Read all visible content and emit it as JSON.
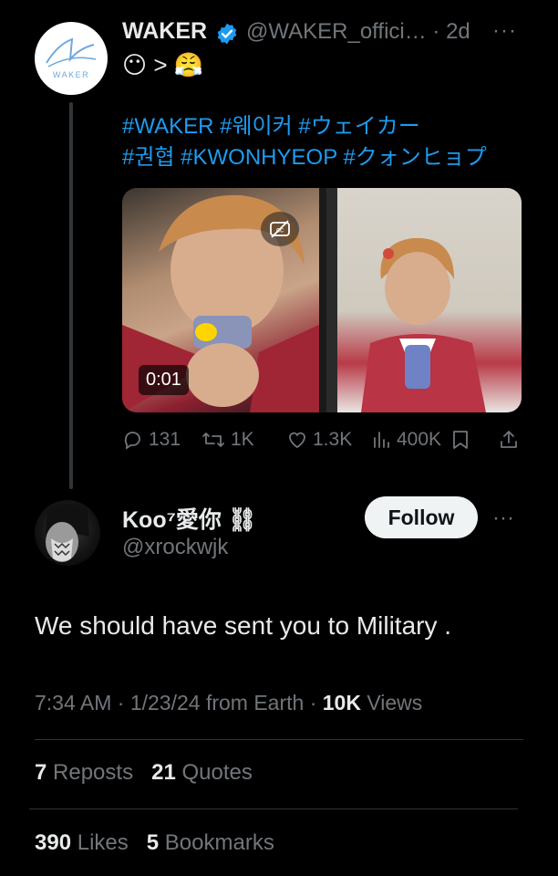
{
  "parent_tweet": {
    "name": "WAKER",
    "handle": "@WAKER_offici…",
    "time_ago": "· 2d",
    "more": "···",
    "emoji_text": "😶 > 😤",
    "hashtags_line1": "#WAKER #웨이커 #ウェイカー",
    "hashtags_line2": "#권협 #KWONHYEOP #クォンヒョプ",
    "avatar_logo_text": "WAKER",
    "video_time": "0:01",
    "actions": {
      "replies": "131",
      "reposts": "1K",
      "likes": "1.3K",
      "views": "400K"
    }
  },
  "reply": {
    "name": "Koo⁷愛你 ⛓",
    "handle": "@xrockwjk",
    "follow_label": "Follow",
    "more": "···",
    "text": "We should have sent you to Military .",
    "meta_prefix": "7:34 AM · 1/23/24 from Earth · ",
    "views_count": "10K",
    "views_label": " Views",
    "reposts_count": "7",
    "reposts_label": " Reposts",
    "quotes_count": "21",
    "quotes_label": " Quotes",
    "likes_count": "390",
    "likes_label": " Likes",
    "bookmarks_count": "5",
    "bookmarks_label": " Bookmarks"
  },
  "colors": {
    "background": "#000000",
    "text": "#e7e9ea",
    "muted": "#71767b",
    "link": "#1d9bf0",
    "verified": "#1d9bf0"
  }
}
